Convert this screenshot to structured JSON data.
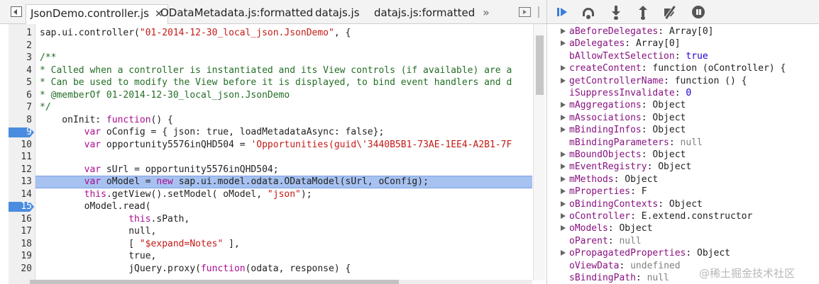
{
  "tabs": [
    {
      "label": "JsonDemo.controller.js",
      "active": true,
      "closable": true
    },
    {
      "label": "ODataMetadata.js:formatted"
    },
    {
      "label": "datajs.js"
    },
    {
      "label": "datajs.js:formatted"
    }
  ],
  "tab_overflow": "»",
  "code_lines": [
    {
      "n": "1",
      "html": "sap.ui.controller(<span class=\"str\">\"01-2014-12-30_local_json.JsonDemo\"</span>, {"
    },
    {
      "n": "2",
      "html": ""
    },
    {
      "n": "3",
      "html": "<span class=\"cm\">/**</span>"
    },
    {
      "n": "4",
      "html": "<span class=\"cm\">* Called when a controller is instantiated and its View controls (if available) are a</span>"
    },
    {
      "n": "5",
      "html": "<span class=\"cm\">* Can be used to modify the View before it is displayed, to bind event handlers and d</span>"
    },
    {
      "n": "6",
      "html": "<span class=\"cm\">* @memberOf 01-2014-12-30_local_json.JsonDemo</span>"
    },
    {
      "n": "7",
      "html": "<span class=\"cm\">*/</span>"
    },
    {
      "n": "8",
      "html": "    onInit: <span class=\"kw\">function</span>() {"
    },
    {
      "n": "9",
      "html": "        <span class=\"kw\">var</span> oConfig = { json: true, loadMetadataAsync: false};",
      "breakpoint": true
    },
    {
      "n": "10",
      "html": "        <span class=\"kw\">var</span> opportunity5576inQHD504 = <span class=\"str\">'Opportunities(guid\\'3440B5B1-73AE-1EE4-A2B1-7F</span>"
    },
    {
      "n": "11",
      "html": ""
    },
    {
      "n": "12",
      "html": "        <span class=\"kw\">var</span> sUrl = opportunity5576inQHD504;"
    },
    {
      "n": "13",
      "html": "        <span class=\"kw\">var</span> oModel = <span class=\"kw\">new</span> sap.ui.model.odata.ODataModel(sUrl, oConfig);",
      "exec": true
    },
    {
      "n": "14",
      "html": "        <span class=\"kw\">this</span>.getView().setModel( oModel, <span class=\"str\">\"json\"</span>);"
    },
    {
      "n": "15",
      "html": "        oModel.read(",
      "breakpoint": true
    },
    {
      "n": "16",
      "html": "                <span class=\"kw\">this</span>.sPath,"
    },
    {
      "n": "17",
      "html": "                null,"
    },
    {
      "n": "18",
      "html": "                [ <span class=\"str\">\"$expand=Notes\"</span> ],"
    },
    {
      "n": "19",
      "html": "                true,"
    },
    {
      "n": "20",
      "html": "                jQuery.proxy(<span class=\"kw\">function</span>(odata, response) {"
    }
  ],
  "properties": [
    {
      "name": "aBeforeDelegates",
      "value": "Array[0]",
      "expandable": true,
      "vtype": "obj"
    },
    {
      "name": "aDelegates",
      "value": "Array[0]",
      "expandable": true,
      "vtype": "obj"
    },
    {
      "name": "bAllowTextSelection",
      "value": "true",
      "expandable": false,
      "vtype": "num"
    },
    {
      "name": "createContent",
      "value": "function (oController) {",
      "expandable": true,
      "vtype": "obj"
    },
    {
      "name": "getControllerName",
      "value": "function () {",
      "expandable": true,
      "vtype": "obj"
    },
    {
      "name": "iSuppressInvalidate",
      "value": "0",
      "expandable": false,
      "vtype": "num"
    },
    {
      "name": "mAggregations",
      "value": "Object",
      "expandable": true,
      "vtype": "obj"
    },
    {
      "name": "mAssociations",
      "value": "Object",
      "expandable": true,
      "vtype": "obj"
    },
    {
      "name": "mBindingInfos",
      "value": "Object",
      "expandable": true,
      "vtype": "obj"
    },
    {
      "name": "mBindingParameters",
      "value": "null",
      "expandable": false,
      "vtype": "null"
    },
    {
      "name": "mBoundObjects",
      "value": "Object",
      "expandable": true,
      "vtype": "obj"
    },
    {
      "name": "mEventRegistry",
      "value": "Object",
      "expandable": true,
      "vtype": "obj"
    },
    {
      "name": "mMethods",
      "value": "Object",
      "expandable": true,
      "vtype": "obj"
    },
    {
      "name": "mProperties",
      "value": "F",
      "expandable": true,
      "vtype": "obj"
    },
    {
      "name": "oBindingContexts",
      "value": "Object",
      "expandable": true,
      "vtype": "obj"
    },
    {
      "name": "oController",
      "value": "E.extend.constructor",
      "expandable": true,
      "vtype": "obj"
    },
    {
      "name": "oModels",
      "value": "Object",
      "expandable": true,
      "vtype": "obj"
    },
    {
      "name": "oParent",
      "value": "null",
      "expandable": false,
      "vtype": "null"
    },
    {
      "name": "oPropagatedProperties",
      "value": "Object",
      "expandable": true,
      "vtype": "obj"
    },
    {
      "name": "oViewData",
      "value": "undefined",
      "expandable": false,
      "vtype": "null"
    },
    {
      "name": "sBindingPath",
      "value": "null",
      "expandable": false,
      "vtype": "null"
    }
  ],
  "watermark": "@稀土掘金技术社区",
  "colors": {
    "breakpoint": "#4a8ce0",
    "execution_line": "#a7c2f0",
    "property_name": "#881280"
  }
}
